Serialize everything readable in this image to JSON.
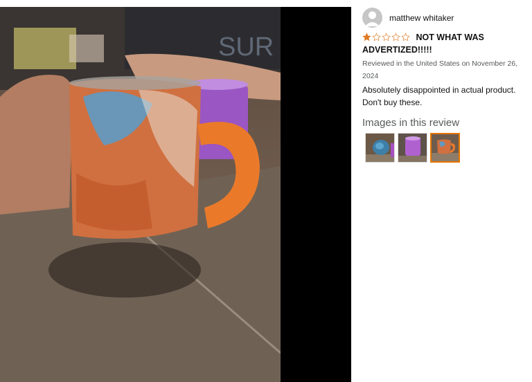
{
  "review": {
    "reviewer_name": "matthew whitaker",
    "rating": 1,
    "rating_max": 5,
    "title": "NOT WHAT WAS ADVERTIZED!!!!!",
    "meta": "Reviewed in the United States on November 26, 2024",
    "body": "Absolutely disappointed in actual product. Don't buy these.",
    "images_heading": "Images in this review",
    "thumbnails": [
      {
        "name": "thumb-blue-mug"
      },
      {
        "name": "thumb-purple-mug"
      },
      {
        "name": "thumb-orange-mug",
        "selected": true
      }
    ]
  },
  "colors": {
    "star_fill": "#de7921",
    "selected_border": "#e77600",
    "meta_text": "#565959"
  }
}
